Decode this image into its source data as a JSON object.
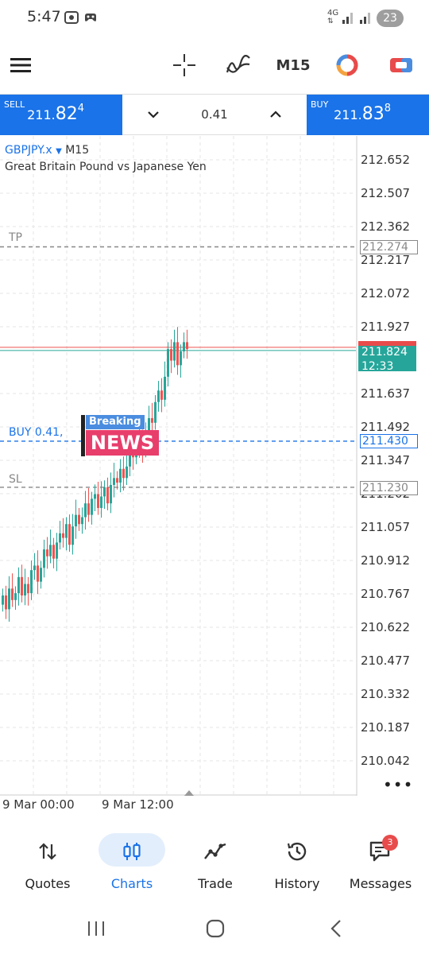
{
  "status_bar": {
    "time": "5:47",
    "network": "4G",
    "battery": "23"
  },
  "toolbar": {
    "timeframe": "M15"
  },
  "trade_panel": {
    "sell": {
      "label": "SELL",
      "price_prefix": "211.",
      "price_big": "82",
      "price_sup": "4"
    },
    "buy": {
      "label": "BUY",
      "price_prefix": "211.",
      "price_big": "83",
      "price_sup": "8"
    },
    "volume": "0.41"
  },
  "chart": {
    "symbol": "GBPJPY.x",
    "timeframe": "M15",
    "description": "Great Britain Pound vs Japanese Yen",
    "price_axis": [
      "212.652",
      "212.507",
      "212.362",
      "212.217",
      "212.072",
      "211.927",
      "211.637",
      "211.492",
      "211.347",
      "211.202",
      "211.057",
      "210.912",
      "210.767",
      "210.622",
      "210.477",
      "210.332",
      "210.187",
      "210.042"
    ],
    "levels": {
      "tp": {
        "label": "TP",
        "price": "212.274",
        "color": "#888888"
      },
      "buy": {
        "label": "BUY 0.41,",
        "price": "211.430",
        "color": "#1a73e8"
      },
      "sl": {
        "label": "SL",
        "price": "211.230",
        "color": "#888888"
      }
    },
    "bid": {
      "price": "211.824",
      "timer": "12:33"
    },
    "time_axis": [
      "9 Mar 00:00",
      "9 Mar 12:00"
    ],
    "news_badge": {
      "top": "Breaking",
      "main": "NEWS"
    },
    "colors": {
      "bull": "#26a69a",
      "bear": "#ef5350",
      "grid": "#e6e6e6"
    }
  },
  "bottom_nav": [
    {
      "label": "Quotes",
      "active": false
    },
    {
      "label": "Charts",
      "active": true
    },
    {
      "label": "Trade",
      "active": false
    },
    {
      "label": "History",
      "active": false
    },
    {
      "label": "Messages",
      "active": false
    }
  ],
  "messages_badge": "3"
}
